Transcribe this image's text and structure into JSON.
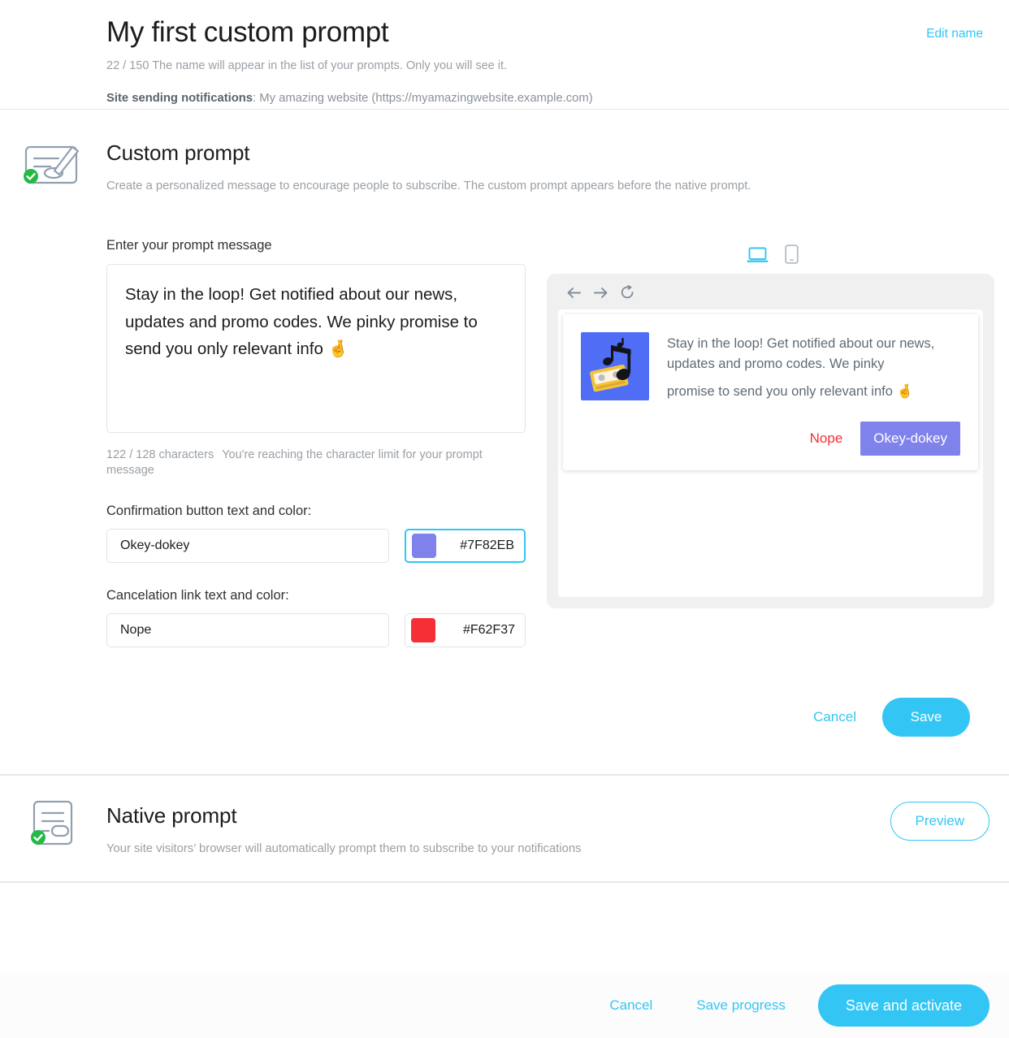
{
  "header": {
    "title": "My first custom prompt",
    "edit_name_label": "Edit name",
    "name_counter": "22 / 150",
    "name_hint": "The name will appear in the list of your prompts. Only you will see it.",
    "site_label": "Site sending notifications",
    "site_value": ": My amazing website (https://myamazingwebsite.example.com)"
  },
  "custom_prompt": {
    "title": "Custom prompt",
    "description": "Create a personalized message to encourage people to subscribe. The custom prompt appears before the native prompt.",
    "status_icon": "check-badge-icon",
    "section_icon": "prompt-brush-icon",
    "message_label": "Enter your prompt message",
    "message_value": "Stay in the loop! Get notified about our news, updates and promo codes. We pinky promise to send you only relevant info 🤞",
    "char_counter": "122 / 128 characters",
    "char_warning": "You're reaching the character limit for your prompt message",
    "confirm_label": "Confirmation button text and color:",
    "confirm_text": "Okey-dokey",
    "confirm_color": "#7F82EB",
    "cancel_label": "Cancelation link text and color:",
    "cancel_text": "Nope",
    "cancel_color": "#F62F37",
    "actions": {
      "cancel_label": "Cancel",
      "save_label": "Save"
    }
  },
  "preview": {
    "devices": [
      {
        "name": "desktop-preview-tab",
        "icon": "laptop-icon",
        "active": true
      },
      {
        "name": "mobile-preview-tab",
        "icon": "phone-icon",
        "active": false
      }
    ],
    "browser_nav": [
      {
        "name": "browser-back-icon",
        "glyph": "←"
      },
      {
        "name": "browser-forward-icon",
        "glyph": "→"
      },
      {
        "name": "browser-reload-icon",
        "glyph": "↺"
      }
    ],
    "notification": {
      "thumbnail_icon": "cassette-music-icon",
      "line1": "Stay in the loop! Get notified about our",
      "line2": "news, updates and promo codes. We pinky",
      "line3": "promise to send you only relevant info 🤞",
      "cancel_text": "Nope",
      "confirm_text": "Okey-dokey"
    }
  },
  "native_prompt": {
    "title": "Native prompt",
    "description": "Your site visitors’ browser will automatically prompt them to subscribe to your notifications",
    "section_icon": "native-doc-icon",
    "status_icon": "check-badge-icon",
    "preview_label": "Preview"
  },
  "footer": {
    "cancel_label": "Cancel",
    "save_progress_label": "Save progress",
    "save_activate_label": "Save and activate"
  },
  "colors": {
    "accent": "#33C6F4",
    "success": "#21BA45",
    "muted": "#9AA0A6",
    "confirm": "#7F82EB",
    "cancel": "#F62F37"
  }
}
